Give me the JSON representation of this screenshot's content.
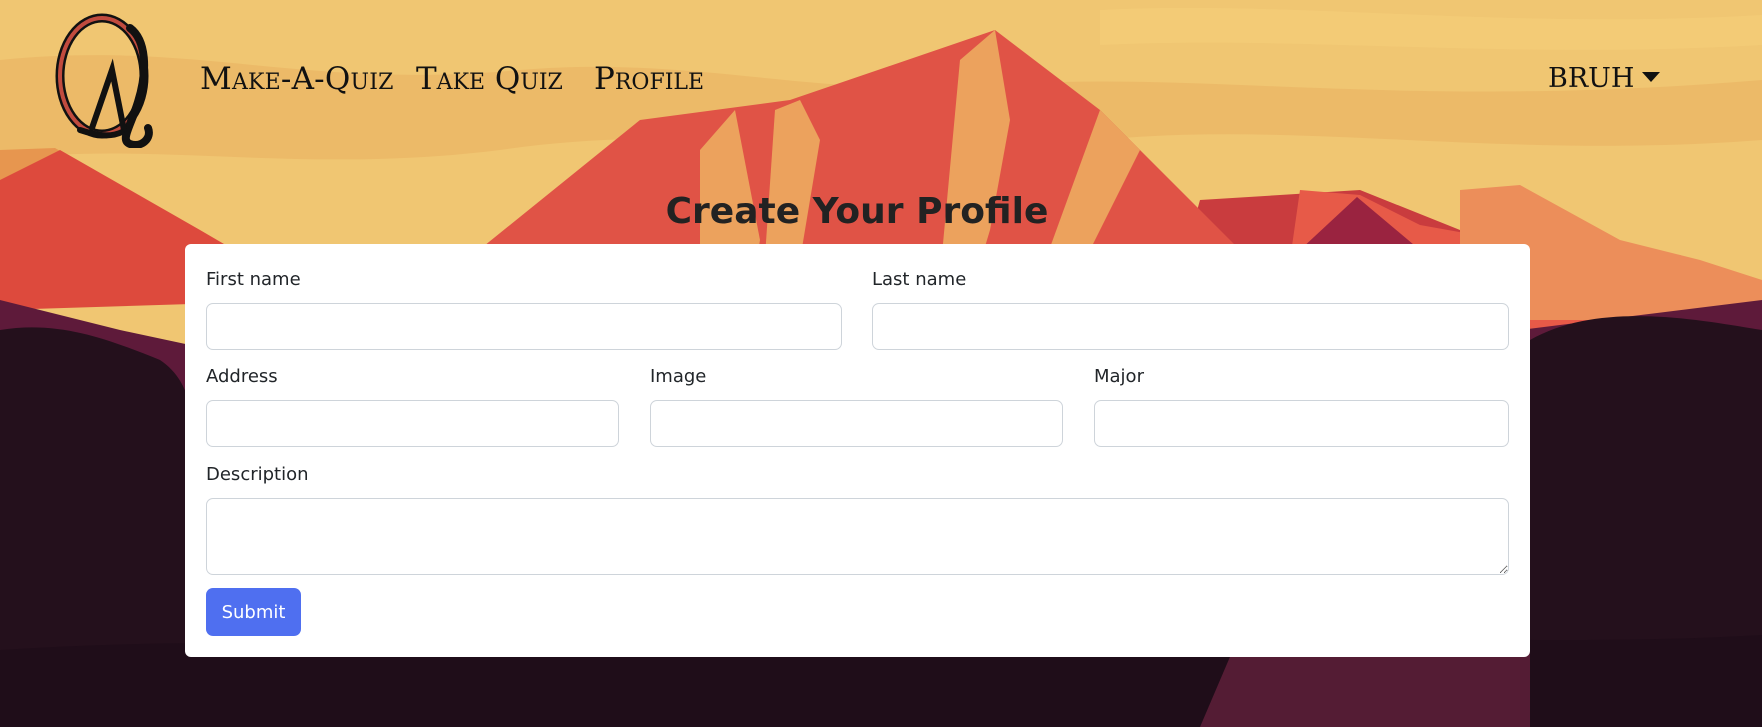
{
  "nav": {
    "logo_icon": "quiz-q-logo-icon",
    "links": [
      "Make-A-Quiz",
      "Take Quiz",
      "Profile"
    ],
    "user": "bruh",
    "user_caret_icon": "caret-down-icon"
  },
  "page": {
    "title": "Create Your Profile"
  },
  "form": {
    "first_name": {
      "label": "First name",
      "value": ""
    },
    "last_name": {
      "label": "Last name",
      "value": ""
    },
    "address": {
      "label": "Address",
      "value": ""
    },
    "image": {
      "label": "Image",
      "value": ""
    },
    "major": {
      "label": "Major",
      "value": ""
    },
    "description": {
      "label": "Description",
      "value": ""
    },
    "submit_label": "Submit"
  },
  "colors": {
    "sky": "#f0c672",
    "mountain_red": "#e05346",
    "mountain_orange": "#eca25d",
    "forest_dark": "#2a1220",
    "button_blue": "#4f6ff0"
  }
}
